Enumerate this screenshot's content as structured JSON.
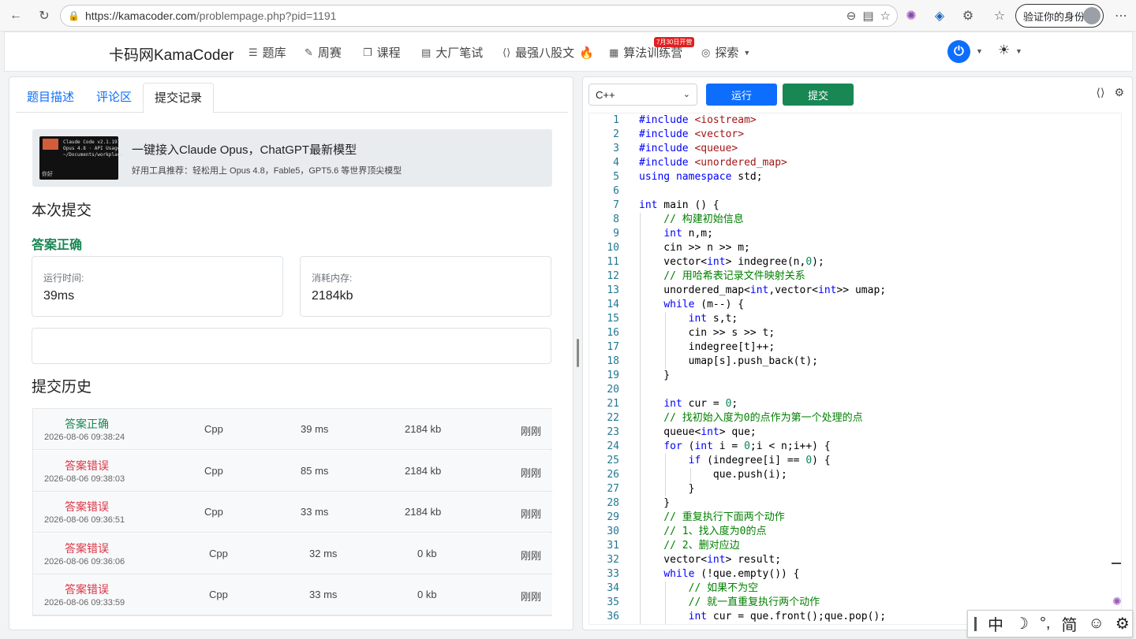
{
  "browser": {
    "url_host": "https://kamacoder.com",
    "url_path": "/problempage.php?pid=1191",
    "profile_label": "验证你的身份"
  },
  "nav": {
    "brand": "卡码网KamaCoder",
    "items": [
      "题库",
      "周赛",
      "课程",
      "大厂笔试",
      "最强八股文",
      "算法训练营",
      "探索"
    ],
    "badge": "7月30日开营",
    "power_icon": "power-icon",
    "theme_icon": "sun-icon"
  },
  "left": {
    "tabs": [
      "题目描述",
      "评论区",
      "提交记录"
    ],
    "active_tab": "提交记录",
    "ad": {
      "title": "一键接入Claude Opus，ChatGPT最新模型",
      "subtitle": "好用工具推荐：轻松用上 Opus 4.8，Fable5，GPT5.6 等世界顶尖模型",
      "thumb_text": "Claude Code v2.1.197\nOpus 4.8 · API Usage\n~/Documents/workplace",
      "thumb_caption": "你好"
    },
    "current_heading": "本次提交",
    "result": "答案正确",
    "runtime_label": "运行时间:",
    "runtime_value": "39ms",
    "memory_label": "消耗内存:",
    "memory_value": "2184kb",
    "history_heading": "提交历史",
    "history": [
      {
        "status": "答案正确",
        "ok": true,
        "time": "2026-08-06 09:38:24",
        "lang": "Cpp",
        "runtime": "39 ms",
        "memory": "2184 kb",
        "when": "刚刚"
      },
      {
        "status": "答案错误",
        "ok": false,
        "time": "2026-08-06 09:38:03",
        "lang": "Cpp",
        "runtime": "85 ms",
        "memory": "2184 kb",
        "when": "刚刚"
      },
      {
        "status": "答案错误",
        "ok": false,
        "time": "2026-08-06 09:36:51",
        "lang": "Cpp",
        "runtime": "33 ms",
        "memory": "2184 kb",
        "when": "刚刚"
      },
      {
        "status": "答案错误",
        "ok": false,
        "time": "2026-08-06 09:36:06",
        "lang": "Cpp",
        "runtime": "32 ms",
        "memory": "0 kb",
        "when": "刚刚"
      },
      {
        "status": "答案错误",
        "ok": false,
        "time": "2026-08-06 09:33:59",
        "lang": "Cpp",
        "runtime": "33 ms",
        "memory": "0 kb",
        "when": "刚刚"
      }
    ]
  },
  "editor": {
    "language": "C++",
    "run_label": "运行",
    "submit_label": "提交",
    "lines": [
      "#include <iostream>",
      "#include <vector>",
      "#include <queue>",
      "#include <unordered_map>",
      "using namespace std;",
      "",
      "int main () {",
      "    // 构建初始信息",
      "    int n,m;",
      "    cin >> n >> m;",
      "    vector<int> indegree(n,0);",
      "    // 用哈希表记录文件映射关系",
      "    unordered_map<int,vector<int>> umap;",
      "    while (m--) {",
      "        int s,t;",
      "        cin >> s >> t;",
      "        indegree[t]++;",
      "        umap[s].push_back(t);",
      "    }",
      "",
      "    int cur = 0;",
      "    // 找初始入度为0的点作为第一个处理的点",
      "    queue<int> que;",
      "    for (int i = 0;i < n;i++) {",
      "        if (indegree[i] == 0) {",
      "            que.push(i);",
      "        }",
      "    }",
      "    // 重复执行下面两个动作",
      "    // 1、找入度为0的点",
      "    // 2、删对应边",
      "    vector<int> result;",
      "    while (!que.empty()) {",
      "        // 如果不为空",
      "        // 就一直重复执行两个动作",
      "        int cur = que.front();que.pop();"
    ]
  },
  "ime": {
    "items": [
      "中",
      "☽",
      "°,",
      "简",
      "☺",
      "⚙"
    ]
  }
}
